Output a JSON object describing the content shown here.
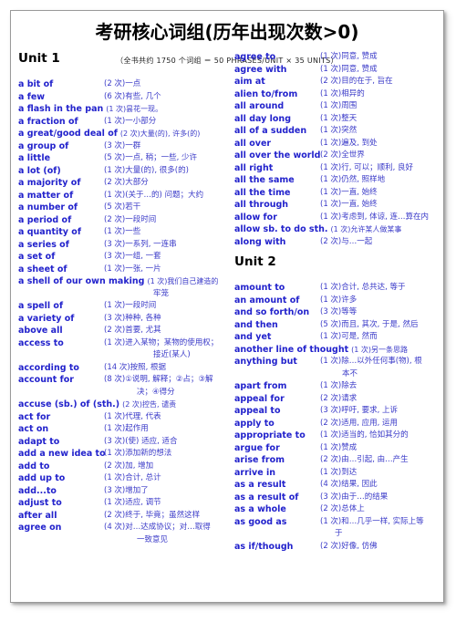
{
  "document": {
    "title": "考研核心词组(历年出现次数>0)",
    "subtitle": "（全书共约 1750 个词组 ＝ 50 PHRASES/UNIT × 35 UNITS）",
    "accent_color": "#2222cc",
    "title_color": "#000000",
    "border_color": "#9a9a9a",
    "background_color": "#ffffff"
  },
  "left_column": {
    "unit_heading": "Unit 1",
    "entries": [
      {
        "term": "a bit of",
        "def": "(2 次)一点"
      },
      {
        "term": "a few",
        "def": "(6 次)有些, 几个"
      },
      {
        "term": "a flash in the pan",
        "def": "(1 次)昙花一现。",
        "wide": true
      },
      {
        "term": "a fraction of",
        "def": "(1 次)一小部分"
      },
      {
        "term": "a great/good deal of",
        "def": "(2 次)大量(的), 许多(的)",
        "wide": true
      },
      {
        "term": "a group of",
        "def": "(3 次)一群"
      },
      {
        "term": "a little",
        "def": "(5 次)一点, 稍；一些, 少许"
      },
      {
        "term": "a lot (of)",
        "def": "(1 次)大量(的), 很多(的)"
      },
      {
        "term": "a majority of",
        "def": "(2 次)大部分"
      },
      {
        "term": "a matter of",
        "def": "(1 次)(关于…的) 问题；大约"
      },
      {
        "term": "a number of",
        "def": "(5 次)若干"
      },
      {
        "term": "a period of",
        "def": "(2 次)一段时间"
      },
      {
        "term": "a quantity of",
        "def": "(1 次)一些"
      },
      {
        "term": "a series of",
        "def": "(3 次)一系列, 一连串"
      },
      {
        "term": "a set of",
        "def": "(3 次)一组, 一套"
      },
      {
        "term": "a sheet of",
        "def": "(1 次)一张, 一片"
      },
      {
        "term": "a shell of our own making",
        "def": "(1 次)我们自己建造的",
        "wide": true,
        "cont": "牢笼",
        "cont_indent": "ind2"
      },
      {
        "term": "a spell of",
        "def": "(1 次)一段时间"
      },
      {
        "term": "a variety of",
        "def": "(3 次)种种, 各种"
      },
      {
        "term": "above all",
        "def": "(2 次)首要, 尤其"
      },
      {
        "term": "access to",
        "def": "(1 次)进入某物；某物的使用权；",
        "cont": "接近(某人)",
        "cont_indent": "ind2"
      },
      {
        "term": "according to",
        "def": "(14 次)按照, 根据"
      },
      {
        "term": "account for",
        "def": "(8 次)①说明, 解释；②占；③解",
        "cont": "决；④得分",
        "cont_indent": "ind1"
      },
      {
        "term": "accuse (sb.) of (sth.)",
        "def": "(2 次)控告, 谴责",
        "wide": true
      },
      {
        "term": "act for",
        "def": "(1 次)代理, 代表"
      },
      {
        "term": "act on",
        "def": "(1 次)起作用"
      },
      {
        "term": "adapt to",
        "def": "(3 次)(使) 适应, 适合"
      },
      {
        "term": "add a new idea to",
        "def": "(1 次)添加新的想法"
      },
      {
        "term": "add to",
        "def": "(2 次)加, 增加"
      },
      {
        "term": "add up to",
        "def": "(1 次)合计, 总计"
      },
      {
        "term": "add...to",
        "def": "(3 次)增加了"
      },
      {
        "term": "adjust to",
        "def": "(1 次)适应, 调节"
      },
      {
        "term": "after all",
        "def": "(2 次)终于, 毕竟；虽然这样"
      },
      {
        "term": "agree on",
        "def": "(4 次)对…达成协议；对…取得",
        "cont": "一致意见",
        "cont_indent": "ind1"
      }
    ]
  },
  "right_column": {
    "entries_top": [
      {
        "term": "agree to",
        "def": "(1 次)同意, 赞成"
      },
      {
        "term": "agree with",
        "def": "(1 次)同意, 赞成"
      },
      {
        "term": "aim at",
        "def": "(2 次)目的在于, 旨在"
      },
      {
        "term": "alien to/from",
        "def": "(1 次)相异的"
      },
      {
        "term": "all around",
        "def": "(1 次)周围"
      },
      {
        "term": "all day long",
        "def": "(1 次)整天"
      },
      {
        "term": "all of a sudden",
        "def": "(1 次)突然"
      },
      {
        "term": "all over",
        "def": "(1 次)遍及, 到处"
      },
      {
        "term": "all over the world",
        "def": "(2 次)全世界"
      },
      {
        "term": "all right",
        "def": "(1 次)行, 可以；顺利, 良好"
      },
      {
        "term": "all the same",
        "def": "(1 次)仍然, 照样地"
      },
      {
        "term": "all the time",
        "def": "(1 次)一直, 始终"
      },
      {
        "term": "all through",
        "def": "(1 次)一直, 始终"
      },
      {
        "term": "allow for",
        "def": "(1 次)考虑到, 体谅, 连…算在内"
      },
      {
        "term": "allow sb. to do sth.",
        "def": "(1 次)允许某人做某事",
        "wide": true
      },
      {
        "term": "along with",
        "def": "(2 次)与…一起"
      }
    ],
    "unit_heading": "Unit 2",
    "entries_bottom": [
      {
        "term": "amount to",
        "def": "(1 次)合计, 总共达, 等于"
      },
      {
        "term": "an amount of",
        "def": "(1 次)许多"
      },
      {
        "term": "and so forth/on",
        "def": "(3 次)等等"
      },
      {
        "term": "and then",
        "def": "(5 次)而且, 其次, 于是, 然后"
      },
      {
        "term": "and yet",
        "def": "(1 次)可是, 然而"
      },
      {
        "term": "another line of thought",
        "def": "(1 次)另一条思路",
        "wide": true
      },
      {
        "term": "anything but",
        "def": "(1 次)除…以外任何事(物), 根",
        "cont": "本不",
        "cont_indent": "ind4"
      },
      {
        "term": "apart from",
        "def": "(1 次)除去"
      },
      {
        "term": "appeal for",
        "def": "(2 次)请求"
      },
      {
        "term": "appeal to",
        "def": "(3 次)呼吁, 要求, 上诉"
      },
      {
        "term": "apply to",
        "def": "(2 次)适用, 应用, 运用"
      },
      {
        "term": "appropriate to",
        "def": "(1 次)适当的, 恰如其分的"
      },
      {
        "term": "argue for",
        "def": "(1 次)赞成"
      },
      {
        "term": "arise from",
        "def": "(2 次)由…引起, 由…产生"
      },
      {
        "term": "arrive in",
        "def": "(1 次)到达"
      },
      {
        "term": "as a result",
        "def": "(4 次)结果, 因此"
      },
      {
        "term": "as a result of",
        "def": "(3 次)由于…的结果"
      },
      {
        "term": "as a whole",
        "def": "(2 次)总体上"
      },
      {
        "term": "as good as",
        "def": "(1 次)和…几乎一样, 实际上等",
        "cont": "于",
        "cont_indent": "ind3"
      },
      {
        "term": "as if/though",
        "def": "(2 次)好像, 仿佛"
      }
    ]
  }
}
